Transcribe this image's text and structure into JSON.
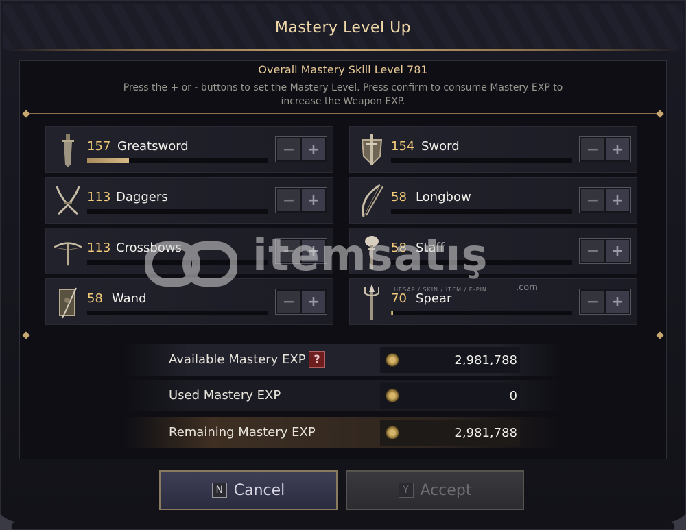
{
  "dialog": {
    "title": "Mastery Level Up",
    "overall": "Overall Mastery Skill Level 781",
    "instructions": "Press the + or - buttons to set the Mastery Level. Press confirm to consume Mastery EXP to increase the Weapon EXP."
  },
  "weapons": [
    {
      "level": "157",
      "name": "Greatsword",
      "progress": 0.23,
      "icon": "greatsword-icon"
    },
    {
      "level": "154",
      "name": "Sword",
      "progress": 0.0,
      "icon": "sword-shield-icon"
    },
    {
      "level": "113",
      "name": "Daggers",
      "progress": 0.0,
      "icon": "daggers-icon"
    },
    {
      "level": "58",
      "name": "Longbow",
      "progress": 0.0,
      "icon": "longbow-icon"
    },
    {
      "level": "113",
      "name": "Crossbows",
      "progress": 0.0,
      "icon": "crossbow-icon"
    },
    {
      "level": "58",
      "name": "Staff",
      "progress": 0.0,
      "icon": "staff-icon"
    },
    {
      "level": "58",
      "name": "Wand",
      "progress": 0.0,
      "icon": "wand-tome-icon"
    },
    {
      "level": "70",
      "name": "Spear",
      "progress": 0.01,
      "icon": "spear-icon"
    }
  ],
  "stepper": {
    "minus": "−",
    "plus": "+"
  },
  "exp": {
    "available_label": "Available Mastery EXP",
    "available_value": "2,981,788",
    "help": "?",
    "used_label": "Used Mastery EXP",
    "used_value": "0",
    "remaining_label": "Remaining Mastery EXP",
    "remaining_value": "2,981,788"
  },
  "actions": {
    "cancel_key": "N",
    "cancel_label": "Cancel",
    "accept_key": "Y",
    "accept_label": "Accept"
  },
  "watermark": {
    "brand": "itemsatış",
    "tagline": "HESAP / SKIN / ITEM / E-PIN",
    "domain": ".com"
  },
  "colors": {
    "accent_gold": "#f0c878",
    "title_gold": "#f0d9a8",
    "progress_fill": "#d8ba86",
    "help_red": "#6e1e1e"
  }
}
